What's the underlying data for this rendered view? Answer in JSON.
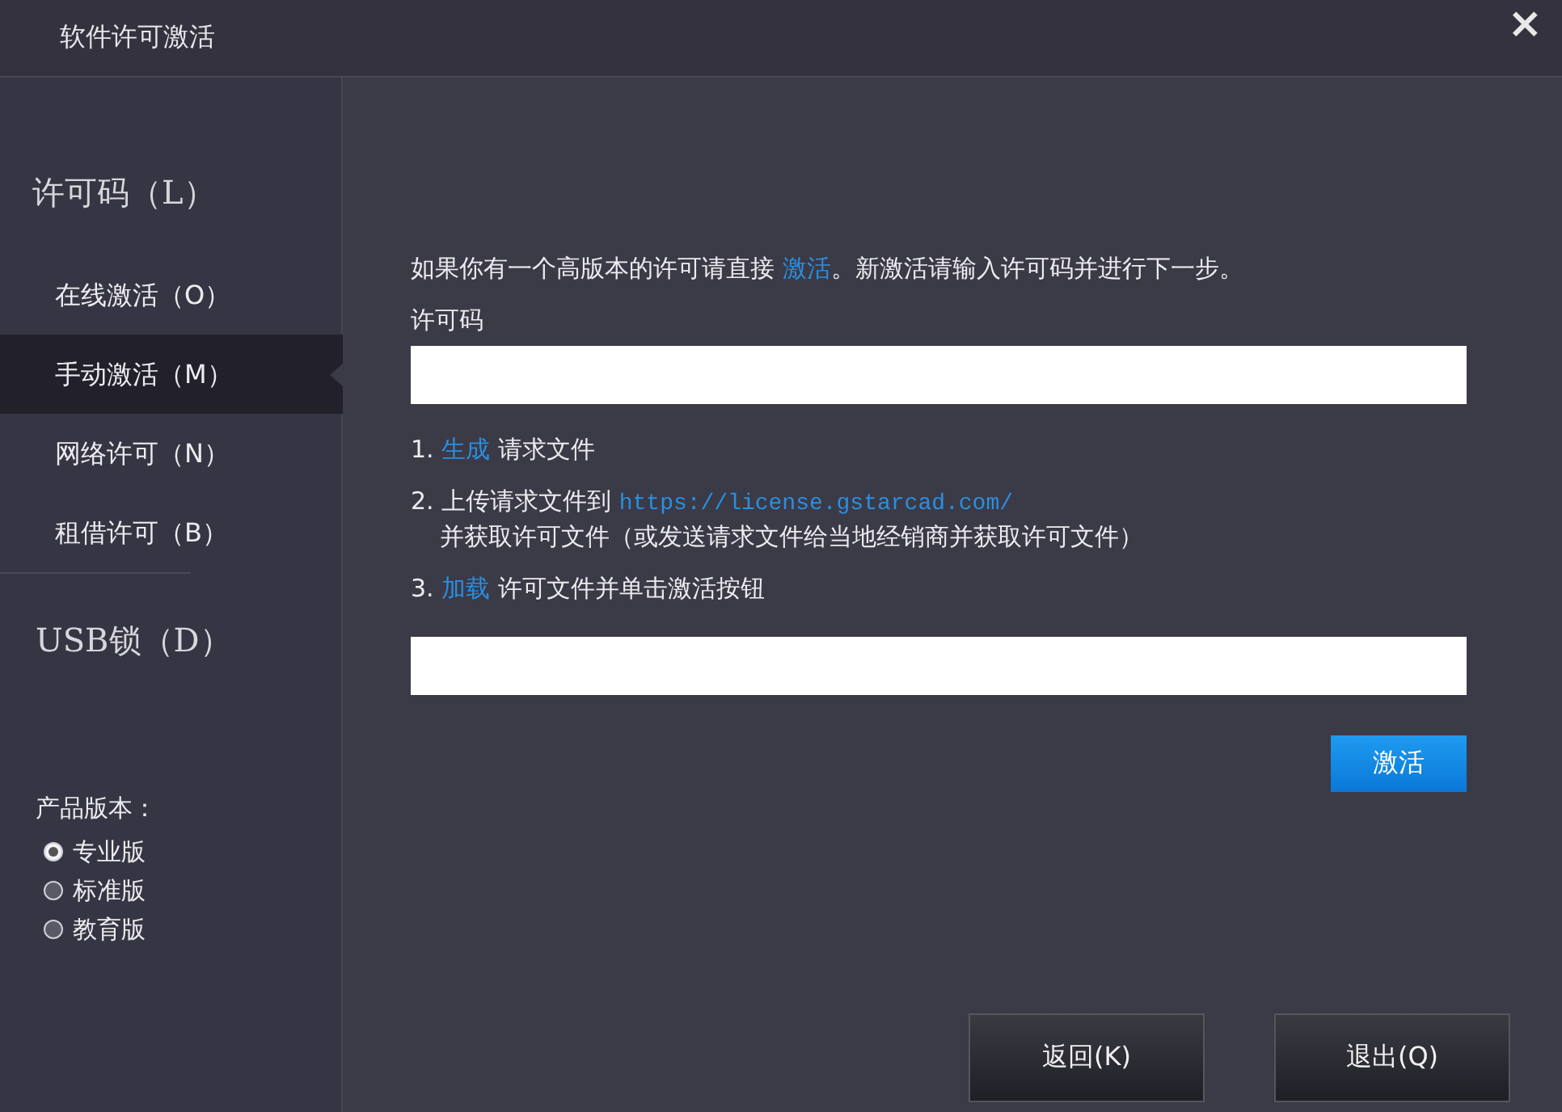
{
  "window": {
    "title": "软件许可激活",
    "close": "×"
  },
  "sidebar": {
    "sections": [
      {
        "label": "许可码（L）",
        "items": [
          {
            "label": "在线激活（O）",
            "selected": false
          },
          {
            "label": "手动激活（M）",
            "selected": true
          },
          {
            "label": "网络许可（N）",
            "selected": false
          },
          {
            "label": "租借许可（B）",
            "selected": false
          }
        ]
      },
      {
        "label": "USB锁（D）"
      }
    ],
    "edition": {
      "label": "产品版本：",
      "options": [
        {
          "label": "专业版",
          "selected": true
        },
        {
          "label": "标准版",
          "selected": false
        },
        {
          "label": "教育版",
          "selected": false
        }
      ]
    }
  },
  "content": {
    "intro": {
      "before": "如果你有一个高版本的许可请直接 ",
      "link": "激活",
      "after": "。新激活请输入许可码并进行下一步。"
    },
    "license_label": "许可码",
    "steps": [
      {
        "number": "1.",
        "link": "生成",
        "after": "请求文件"
      },
      {
        "number": "2.",
        "before": "上传请求文件到 ",
        "link": "https://license.gstarcad.com/",
        "second_line": "并获取许可文件（或发送请求文件给当地经销商并获取许可文件）"
      },
      {
        "number": "3.",
        "link": "加载",
        "after": "许可文件并单击激活按钮"
      }
    ],
    "activate_button": "激活"
  },
  "footer": {
    "buttons": [
      "返回(K)",
      "退出(Q)"
    ]
  }
}
